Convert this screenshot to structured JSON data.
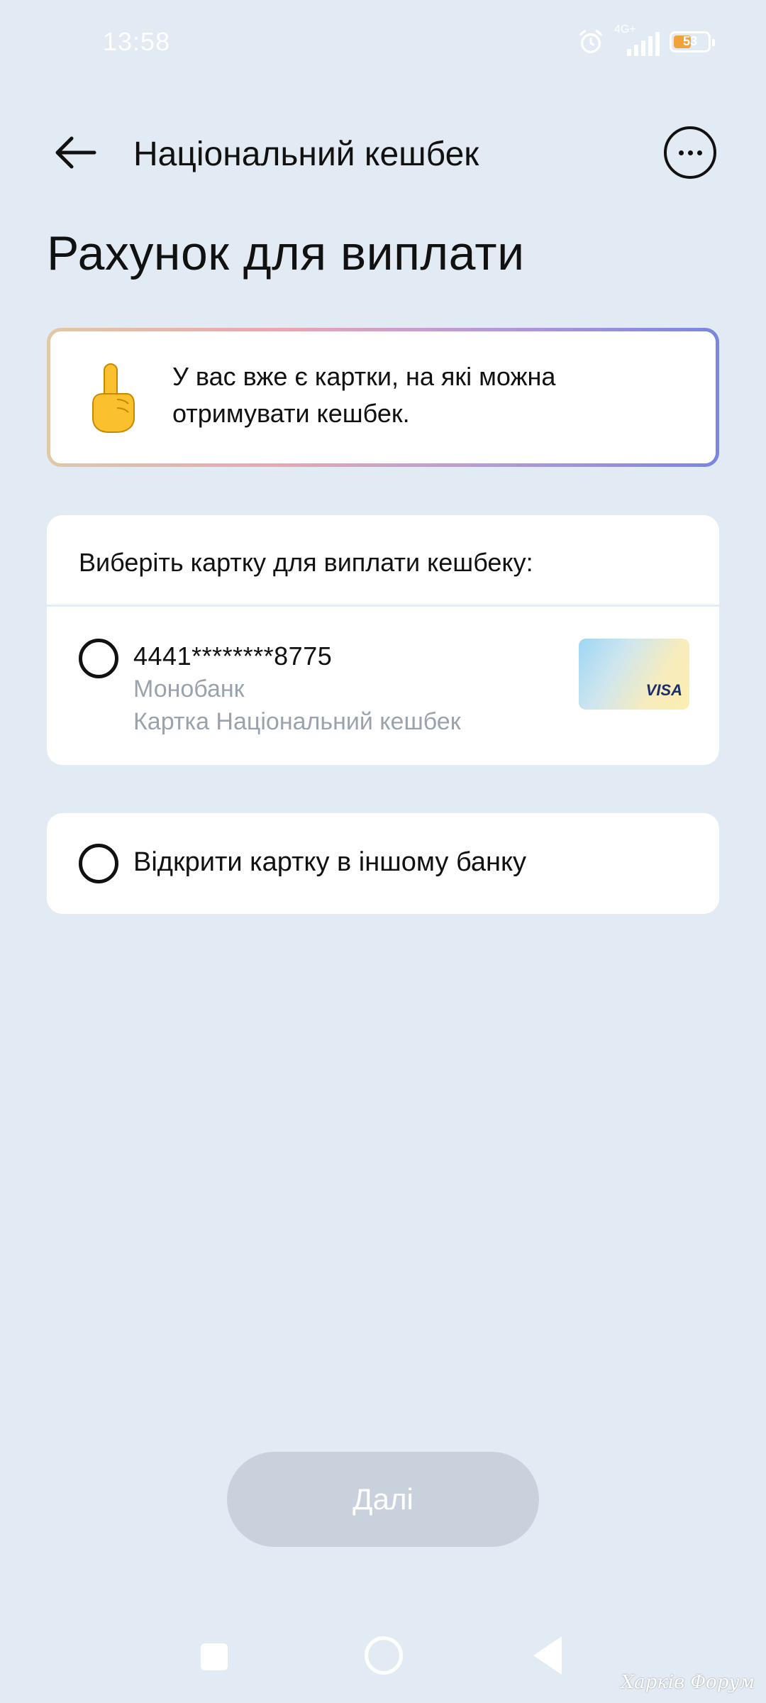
{
  "status_bar": {
    "time": "13:58",
    "network": "4G+",
    "battery": "53",
    "battery_level": 0.53
  },
  "header": {
    "back_icon": "arrow-left-icon",
    "title": "Національний кешбек",
    "more_icon": "more-horizontal-icon"
  },
  "page_title": "Рахунок для виплати",
  "banner": {
    "icon": "pointing-up-hand-emoji",
    "text": "У вас вже є картки, на які можна отримувати кешбек."
  },
  "card_panel": {
    "title": "Виберіть картку для виплати кешбеку:",
    "card": {
      "number": "4441********8775",
      "bank": "Монобанк",
      "type": "Картка Національний кешбек",
      "network": "VISA",
      "selected": false
    }
  },
  "other_bank": {
    "label": "Відкрити картку в іншому банку",
    "selected": false
  },
  "next_button": {
    "label": "Далі",
    "enabled": false
  },
  "watermark": "Харків Форум",
  "colors": {
    "background": "#e2ebf4",
    "panel": "#ffffff",
    "disabled_button": "#c9d2dc",
    "muted_text": "#9aa3ad",
    "battery": "#f0a33a"
  }
}
